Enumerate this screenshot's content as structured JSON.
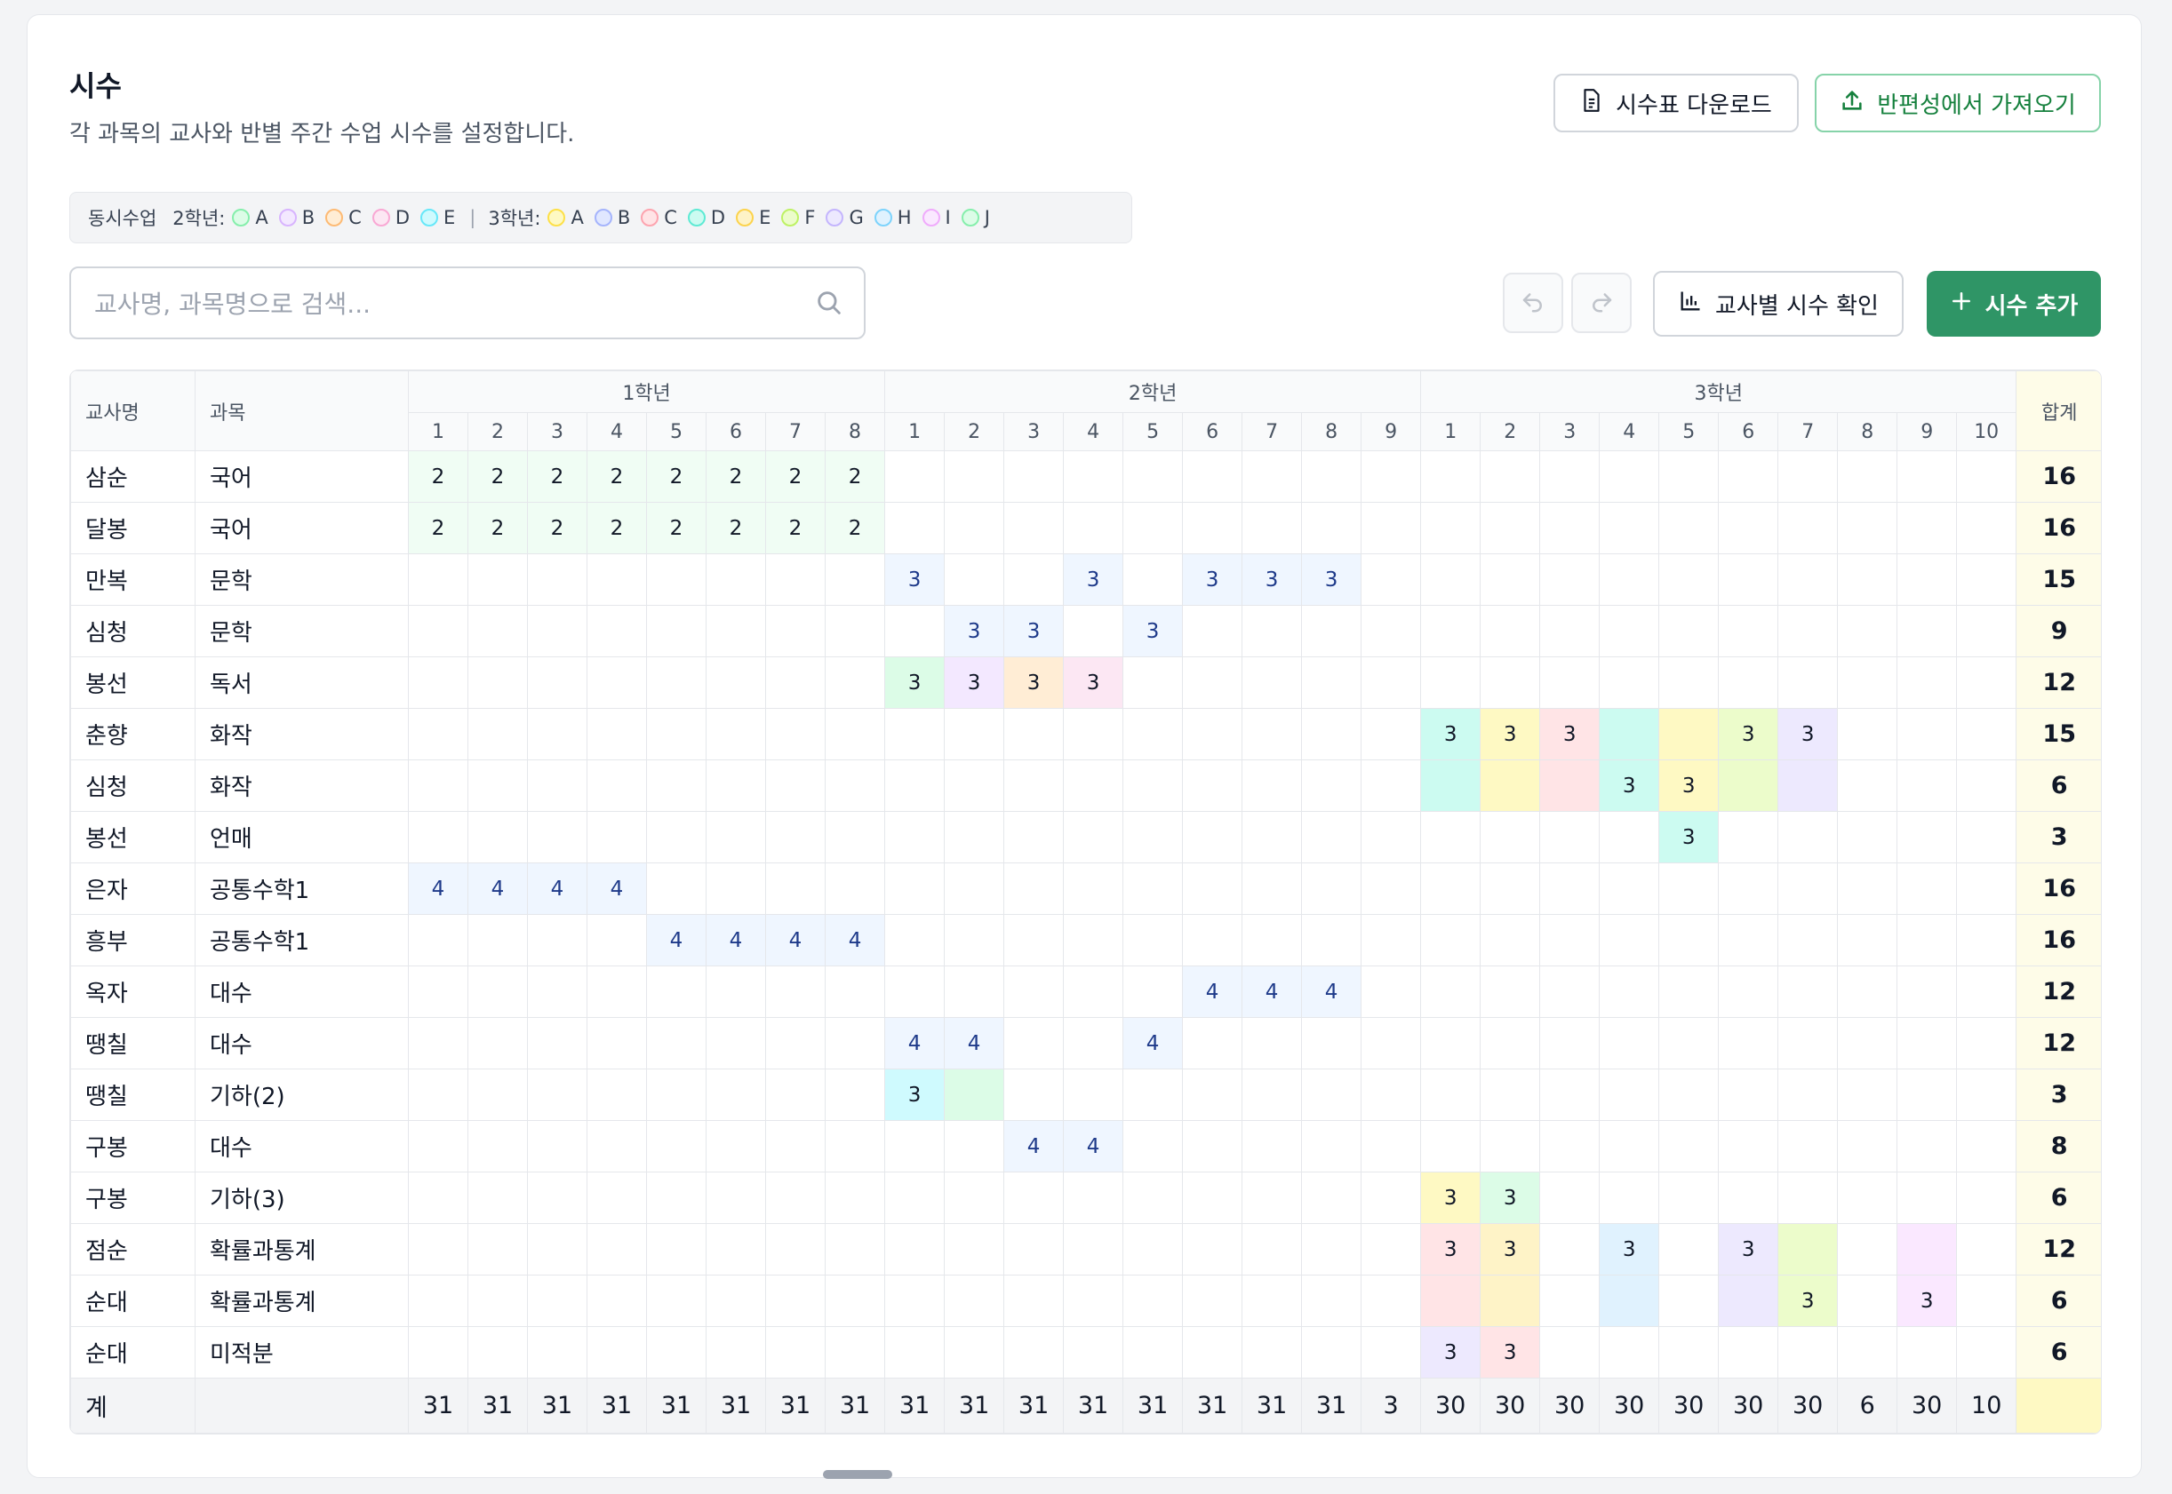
{
  "header": {
    "title": "시수",
    "subtitle": "각 과목의 교사와 반별 주간 수업 시수를 설정합니다.",
    "download_label": "시수표 다운로드",
    "import_label": "반편성에서 가져오기"
  },
  "legend": {
    "label": "동시수업",
    "groups": [
      {
        "grade": "2학년:",
        "items": [
          {
            "letter": "A",
            "fill": "#dcfce7",
            "border": "#86efac"
          },
          {
            "letter": "B",
            "fill": "#f3e8ff",
            "border": "#d8b4fe"
          },
          {
            "letter": "C",
            "fill": "#ffedd5",
            "border": "#fdba74"
          },
          {
            "letter": "D",
            "fill": "#fce7f3",
            "border": "#f9a8d4"
          },
          {
            "letter": "E",
            "fill": "#cffafe",
            "border": "#67e8f9"
          }
        ]
      },
      {
        "grade": "3학년:",
        "items": [
          {
            "letter": "A",
            "fill": "#fef9c3",
            "border": "#fde047"
          },
          {
            "letter": "B",
            "fill": "#e0e7ff",
            "border": "#a5b4fc"
          },
          {
            "letter": "C",
            "fill": "#ffe4e6",
            "border": "#fda4af"
          },
          {
            "letter": "D",
            "fill": "#ccfbf1",
            "border": "#5eead4"
          },
          {
            "letter": "E",
            "fill": "#fef3c7",
            "border": "#fcd34d"
          },
          {
            "letter": "F",
            "fill": "#ecfccb",
            "border": "#bef264"
          },
          {
            "letter": "G",
            "fill": "#ede9fe",
            "border": "#c4b5fd"
          },
          {
            "letter": "H",
            "fill": "#e0f2fe",
            "border": "#7dd3fc"
          },
          {
            "letter": "I",
            "fill": "#fae8ff",
            "border": "#f0abfc"
          },
          {
            "letter": "J",
            "fill": "#dcfce7",
            "border": "#86efac"
          }
        ]
      }
    ]
  },
  "search": {
    "placeholder": "교사명, 과목명으로 검색..."
  },
  "toolbar": {
    "undo_icon": "undo-icon",
    "redo_icon": "redo-icon",
    "check_label": "교사별 시수 확인",
    "add_label": "시수 추가"
  },
  "table": {
    "col_teacher": "교사명",
    "col_subject": "과목",
    "col_total": "합계",
    "grades": [
      {
        "label": "1학년",
        "classes": [
          "1",
          "2",
          "3",
          "4",
          "5",
          "6",
          "7",
          "8"
        ]
      },
      {
        "label": "2학년",
        "classes": [
          "1",
          "2",
          "3",
          "4",
          "5",
          "6",
          "7",
          "8",
          "9"
        ]
      },
      {
        "label": "3학년",
        "classes": [
          "1",
          "2",
          "3",
          "4",
          "5",
          "6",
          "7",
          "8",
          "9",
          "10"
        ]
      }
    ],
    "colors": {
      "g1": "#f0fdf4",
      "blue": "#eff6ff",
      "a2": "#dcfce7",
      "b2": "#f3e8ff",
      "c2": "#ffedd5",
      "d2": "#fce7f3",
      "e2": "#cffafe",
      "a3": "#fef9c3",
      "b3": "#e0e7ff",
      "c3": "#ffe4e6",
      "d3": "#ccfbf1",
      "e3": "#fef3c7",
      "f3": "#ecfccb",
      "g3": "#ede9fe",
      "h3": "#e0f2fe",
      "i3": "#fae8ff",
      "j3": "#dcfce7"
    },
    "rows": [
      {
        "teacher": "삼순",
        "subject": "국어",
        "total": "16",
        "cells": {
          "0": [
            "2",
            "g1"
          ],
          "1": [
            "2",
            "g1"
          ],
          "2": [
            "2",
            "g1"
          ],
          "3": [
            "2",
            "g1"
          ],
          "4": [
            "2",
            "g1"
          ],
          "5": [
            "2",
            "g1"
          ],
          "6": [
            "2",
            "g1"
          ],
          "7": [
            "2",
            "g1"
          ]
        }
      },
      {
        "teacher": "달봉",
        "subject": "국어",
        "total": "16",
        "cells": {
          "0": [
            "2",
            "g1"
          ],
          "1": [
            "2",
            "g1"
          ],
          "2": [
            "2",
            "g1"
          ],
          "3": [
            "2",
            "g1"
          ],
          "4": [
            "2",
            "g1"
          ],
          "5": [
            "2",
            "g1"
          ],
          "6": [
            "2",
            "g1"
          ],
          "7": [
            "2",
            "g1"
          ]
        }
      },
      {
        "teacher": "만복",
        "subject": "문학",
        "total": "15",
        "cells": {
          "8": [
            "3",
            "blue"
          ],
          "11": [
            "3",
            "blue"
          ],
          "13": [
            "3",
            "blue"
          ],
          "14": [
            "3",
            "blue"
          ],
          "15": [
            "3",
            "blue"
          ]
        }
      },
      {
        "teacher": "심청",
        "subject": "문학",
        "total": "9",
        "cells": {
          "9": [
            "3",
            "blue"
          ],
          "10": [
            "3",
            "blue"
          ],
          "12": [
            "3",
            "blue"
          ]
        }
      },
      {
        "teacher": "봉선",
        "subject": "독서",
        "total": "12",
        "cells": {
          "8": [
            "3",
            "a2"
          ],
          "9": [
            "3",
            "b2"
          ],
          "10": [
            "3",
            "c2"
          ],
          "11": [
            "3",
            "d2"
          ]
        }
      },
      {
        "teacher": "춘향",
        "subject": "화작",
        "total": "15",
        "cells": {
          "17": [
            "3",
            "d3"
          ],
          "18": [
            "3",
            "a3"
          ],
          "19": [
            "3",
            "c3"
          ],
          "20": [
            "",
            "d3"
          ],
          "21": [
            "",
            "a3"
          ],
          "22": [
            "3",
            "f3"
          ],
          "23": [
            "3",
            "g3"
          ]
        }
      },
      {
        "teacher": "심청",
        "subject": "화작",
        "total": "6",
        "cells": {
          "17": [
            "",
            "d3"
          ],
          "18": [
            "",
            "a3"
          ],
          "19": [
            "",
            "c3"
          ],
          "20": [
            "3",
            "d3"
          ],
          "21": [
            "3",
            "a3"
          ],
          "22": [
            "",
            "f3"
          ],
          "23": [
            "",
            "g3"
          ]
        }
      },
      {
        "teacher": "봉선",
        "subject": "언매",
        "total": "3",
        "cells": {
          "21": [
            "3",
            "d3"
          ]
        }
      },
      {
        "teacher": "은자",
        "subject": "공통수학1",
        "total": "16",
        "cells": {
          "0": [
            "4",
            "blue"
          ],
          "1": [
            "4",
            "blue"
          ],
          "2": [
            "4",
            "blue"
          ],
          "3": [
            "4",
            "blue"
          ]
        }
      },
      {
        "teacher": "흥부",
        "subject": "공통수학1",
        "total": "16",
        "cells": {
          "4": [
            "4",
            "blue"
          ],
          "5": [
            "4",
            "blue"
          ],
          "6": [
            "4",
            "blue"
          ],
          "7": [
            "4",
            "blue"
          ]
        }
      },
      {
        "teacher": "옥자",
        "subject": "대수",
        "total": "12",
        "cells": {
          "13": [
            "4",
            "blue"
          ],
          "14": [
            "4",
            "blue"
          ],
          "15": [
            "4",
            "blue"
          ]
        }
      },
      {
        "teacher": "땡칠",
        "subject": "대수",
        "total": "12",
        "cells": {
          "8": [
            "4",
            "blue"
          ],
          "9": [
            "4",
            "blue"
          ],
          "12": [
            "4",
            "blue"
          ]
        }
      },
      {
        "teacher": "땡칠",
        "subject": "기하(2)",
        "total": "3",
        "cells": {
          "8": [
            "3",
            "e2"
          ],
          "9": [
            "",
            "a2"
          ]
        }
      },
      {
        "teacher": "구봉",
        "subject": "대수",
        "total": "8",
        "cells": {
          "10": [
            "4",
            "blue"
          ],
          "11": [
            "4",
            "blue"
          ]
        }
      },
      {
        "teacher": "구봉",
        "subject": "기하(3)",
        "total": "6",
        "cells": {
          "17": [
            "3",
            "a3"
          ],
          "18": [
            "3",
            "j3"
          ]
        }
      },
      {
        "teacher": "점순",
        "subject": "확률과통계",
        "total": "12",
        "cells": {
          "17": [
            "3",
            "c3"
          ],
          "18": [
            "3",
            "e3"
          ],
          "20": [
            "3",
            "h3"
          ],
          "22": [
            "3",
            "g3"
          ],
          "23": [
            "",
            "f3"
          ],
          "25": [
            "",
            "i3"
          ]
        }
      },
      {
        "teacher": "순대",
        "subject": "확률과통계",
        "total": "6",
        "cells": {
          "17": [
            "",
            "c3"
          ],
          "18": [
            "",
            "e3"
          ],
          "20": [
            "",
            "h3"
          ],
          "22": [
            "",
            "g3"
          ],
          "23": [
            "3",
            "f3"
          ],
          "25": [
            "3",
            "i3"
          ]
        }
      },
      {
        "teacher": "순대",
        "subject": "미적분",
        "total": "6",
        "cells": {
          "17": [
            "3",
            "g3"
          ],
          "18": [
            "3",
            "c3"
          ]
        }
      }
    ],
    "footer": {
      "label": "계",
      "values": [
        "31",
        "31",
        "31",
        "31",
        "31",
        "31",
        "31",
        "31",
        "31",
        "31",
        "31",
        "31",
        "31",
        "31",
        "31",
        "31",
        "3",
        "30",
        "30",
        "30",
        "30",
        "30",
        "30",
        "30",
        "6",
        "30",
        "10"
      ],
      "total": ""
    }
  }
}
